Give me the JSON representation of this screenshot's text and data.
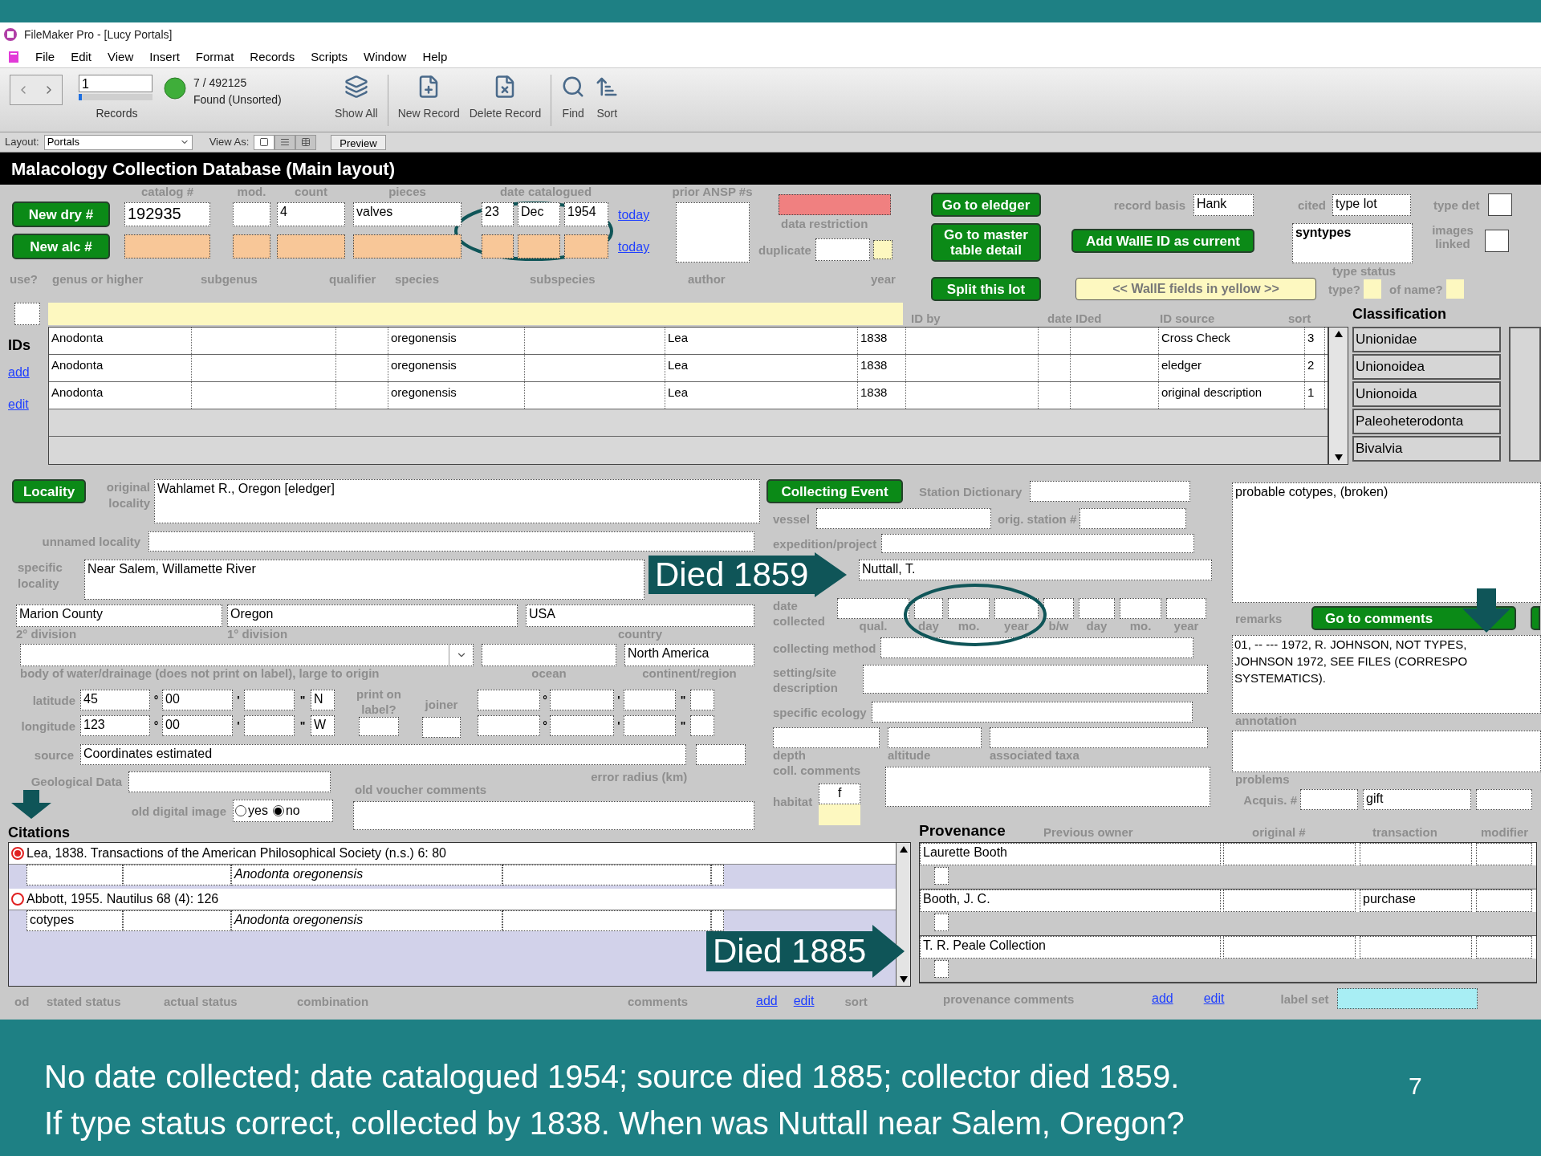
{
  "window": {
    "title": "FileMaker Pro - [Lucy Portals]"
  },
  "menu": [
    "File",
    "Edit",
    "View",
    "Insert",
    "Format",
    "Records",
    "Scripts",
    "Window",
    "Help"
  ],
  "toolbar": {
    "record_number": "1",
    "record_slider": {
      "level": 0
    },
    "records_label": "Records",
    "found_count": "7 / 492125",
    "found_status": "Found (Unsorted)",
    "buttons": [
      {
        "kind": "show_all",
        "label": "Show All"
      },
      {
        "kind": "new_record",
        "label": "New Record"
      },
      {
        "kind": "delete_record",
        "label": "Delete Record"
      },
      {
        "kind": "find",
        "label": "Find"
      },
      {
        "kind": "sort",
        "label": "Sort"
      }
    ]
  },
  "layout_bar": {
    "layout_label": "Layout:",
    "layout": "Portals",
    "view_as_label": "View As:",
    "view_modes": [
      {
        "kind": "form",
        "selected": true
      },
      {
        "kind": "list",
        "selected": false
      },
      {
        "kind": "table",
        "selected": false
      }
    ],
    "preview_button": "Preview"
  },
  "header": "Malacology Collection Database (Main layout)",
  "top_form": {
    "new_dry_button": "New dry #",
    "new_alc_button": "New alc #",
    "catalog": {
      "label": "catalog #",
      "value": "192935"
    },
    "mod": {
      "label": "mod."
    },
    "count": {
      "label": "count",
      "value": "4"
    },
    "pieces": {
      "label": "pieces",
      "value": "valves"
    },
    "date_catalogued": {
      "label": "date catalogued",
      "day": "23",
      "month": "Dec",
      "year": "1954"
    },
    "today_links": [
      "today",
      "today"
    ],
    "prior_ansp": {
      "label": "prior ANSP #s"
    },
    "data_restriction": {
      "label": "data restriction"
    },
    "duplicate": {
      "label": "duplicate"
    },
    "action_buttons": [
      "Go to eledger",
      "Go to master table detail",
      "Split this lot"
    ],
    "record_basis": {
      "label": "record basis",
      "value": "Hank"
    },
    "add_walle_button": "Add WallE ID as current",
    "walle_note": "<< WallE fields in yellow >>",
    "cited": {
      "label": "cited",
      "value": "type lot"
    },
    "type_status": {
      "label": "type status",
      "value": "syntypes"
    },
    "type_det": {
      "label": "type det",
      "checked": false
    },
    "images_linked": {
      "label": "images linked",
      "checked": false
    },
    "use_checkbox": {
      "checked": false
    },
    "type_q": {
      "label": "type?"
    },
    "of_name": {
      "label": "of name?"
    }
  },
  "name_labels": [
    "use?",
    "genus or higher",
    "subgenus",
    "qualifier",
    "species",
    "subspecies",
    "author",
    "year"
  ],
  "ids": {
    "title": "IDs",
    "add_link": "add",
    "edit_link": "edit",
    "column_labels": [
      "ID by",
      "date IDed",
      "ID source",
      "sort"
    ],
    "rows": [
      {
        "genus": "Anodonta",
        "species": "oregonensis",
        "author": "Lea",
        "year": "1838",
        "id_source": "Cross Check",
        "sort": "3"
      },
      {
        "genus": "Anodonta",
        "species": "oregonensis",
        "author": "Lea",
        "year": "1838",
        "id_source": "eledger",
        "sort": "2"
      },
      {
        "genus": "Anodonta",
        "species": "oregonensis",
        "author": "Lea",
        "year": "1838",
        "id_source": "original description",
        "sort": "1"
      }
    ]
  },
  "classification": {
    "title": "Classification",
    "items": [
      "Unionidae",
      "Unionoidea",
      "Unionoida",
      "Paleoheterodonta",
      "Bivalvia"
    ]
  },
  "locality": {
    "button": "Locality",
    "original_locality": {
      "label": "original locality",
      "value": "Wahlamet R., Oregon [eledger]"
    },
    "unnamed_locality": {
      "label": "unnamed locality"
    },
    "specific_locality": {
      "label": "specific locality",
      "value": "Near Salem, Willamette River"
    },
    "division_2": {
      "label": "2° division",
      "value": "Marion County"
    },
    "division_1": {
      "label": "1° division",
      "value": "Oregon"
    },
    "country": {
      "label": "country",
      "value": "USA"
    },
    "body_of_water": {
      "label": "body of water/drainage (does not print on label), large to origin"
    },
    "ocean": {
      "label": "ocean"
    },
    "continent": {
      "label": "continent/region",
      "value": "North America"
    },
    "coordinate_rows": [
      {
        "label": "latitude",
        "degrees": "45",
        "minutes": "00",
        "direction": "N",
        "marks": [
          "°",
          "'",
          "\""
        ],
        "alt_marks": [
          "°",
          "'",
          "\""
        ]
      },
      {
        "label": "longitude",
        "degrees": "123",
        "minutes": "00",
        "direction": "W",
        "marks": [
          "°",
          "'",
          "\""
        ],
        "alt_marks": [
          "°",
          "'",
          "\""
        ]
      }
    ],
    "print_on_label": "print on label?",
    "print_on_label_checkbox": {
      "checked": false
    },
    "joiner": "joiner",
    "source": {
      "label": "source",
      "value": "Coordinates estimated"
    },
    "error_radius": "error radius (km)",
    "geological_data": "Geological Data",
    "old_voucher_comments": "old voucher comments",
    "old_digital_image": {
      "label": "old digital image",
      "options": [
        {
          "label": "yes",
          "selected": false
        },
        {
          "label": "no",
          "selected": true
        }
      ]
    }
  },
  "collecting_event": {
    "button": "Collecting Event",
    "station_dictionary": "Station Dictionary",
    "vessel": "vessel",
    "orig_station": "orig. station #",
    "expedition": "expedition/project",
    "collector": "Nuttall, T.",
    "date_collected": {
      "label": "date collected",
      "sub_labels": [
        "qual.",
        "day",
        "mo.",
        "year",
        "b/w",
        "day",
        "mo.",
        "year"
      ]
    },
    "collecting_method": "collecting method",
    "setting": "setting/site description",
    "specific_ecology": "specific ecology",
    "bottom_labels": [
      "depth",
      "altitude",
      "associated taxa"
    ],
    "coll_comments": "coll. comments",
    "habitat": {
      "label": "habitat",
      "value": "f"
    }
  },
  "remarks": {
    "value": "probable cotypes, (broken)",
    "label": "remarks",
    "comments_button": "Go to comments",
    "annotation_lines": [
      "01, -- --- 1972, R. JOHNSON, NOT TYPES,",
      "JOHNSON 1972, SEE FILES (CORRESPO",
      "SYSTEMATICS)."
    ],
    "annotation_label": "annotation",
    "problems_label": "problems",
    "acquis_label": "Acquis. #",
    "transaction": "gift"
  },
  "citations": {
    "title": "Citations",
    "rows": [
      {
        "text": "Lea, 1838. Transactions of the American Philosophical Society (n.s.) 6: 80",
        "selected": true,
        "combination": "Anodonta oregonensis"
      },
      {
        "text": "Abbott, 1955. Nautilus 68 (4): 126",
        "selected": false,
        "stated_status": "cotypes",
        "combination": "Anodonta oregonensis"
      }
    ],
    "footer_labels": [
      "od",
      "stated status",
      "actual status",
      "combination",
      "comments"
    ],
    "add_link": "add",
    "edit_link": "edit",
    "sort_label": "sort"
  },
  "provenance": {
    "title": "Provenance",
    "column_labels": [
      "Previous owner",
      "original #",
      "transaction",
      "modifier"
    ],
    "rows": [
      {
        "owner": "Laurette Booth"
      },
      {
        "owner": "Booth, J. C.",
        "transaction": "purchase"
      },
      {
        "owner": "T. R. Peale Collection"
      }
    ],
    "comments_label": "provenance comments",
    "add_link": "add",
    "edit_link": "edit",
    "label_set": "label set"
  },
  "callouts": [
    "Died 1859",
    "Died 1885"
  ],
  "caption": {
    "lines": [
      "No date collected; date catalogued 1954; source died 1885; collector died 1859.",
      "If type status correct, collected by 1838. When was Nuttall near Salem, Oregon?"
    ],
    "page_number": "7"
  }
}
